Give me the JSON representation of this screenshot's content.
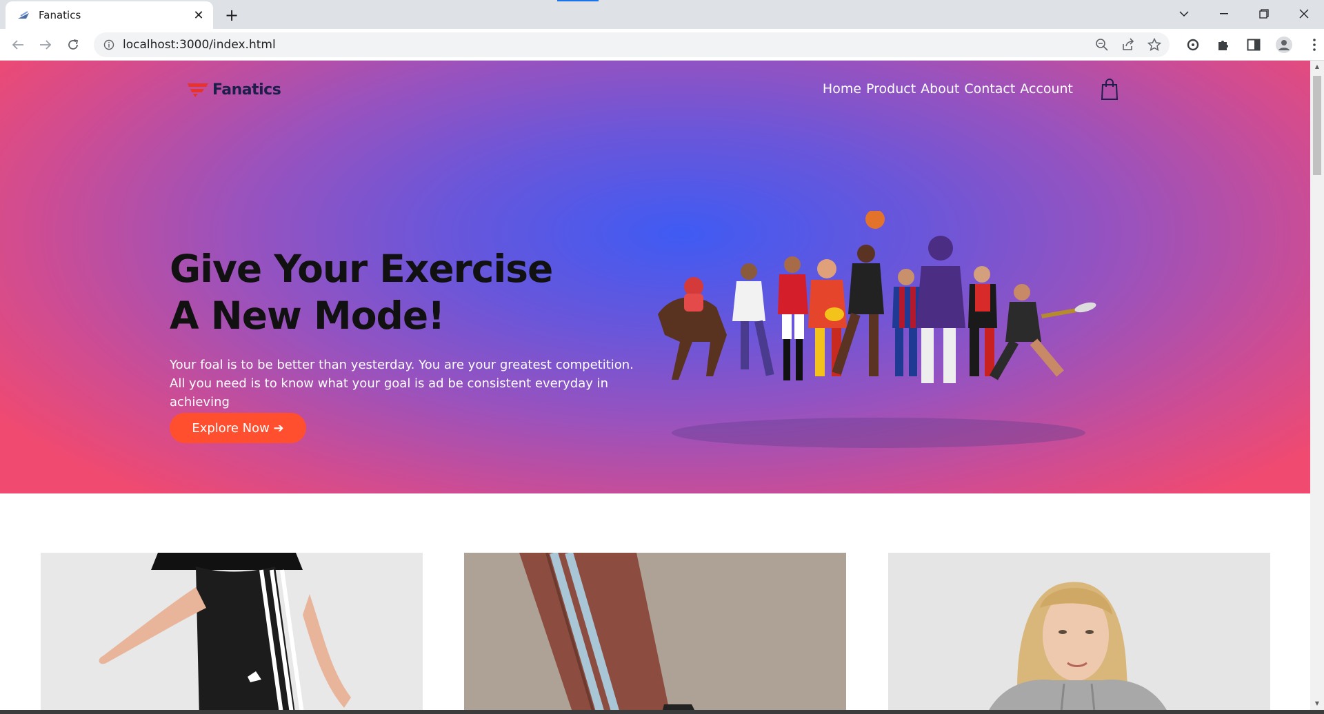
{
  "browser": {
    "tab_title": "Fanatics",
    "url": "localhost:3000/index.html"
  },
  "site": {
    "logo_text": "Fanatics",
    "nav": [
      "Home",
      "Product",
      "About",
      "Contact",
      "Account"
    ],
    "hero": {
      "headline_line1": "Give Your Exercise",
      "headline_line2": "A New Mode!",
      "subtext_line1": "Your foal is to be better than yesterday. You are your greatest competition.",
      "subtext_line2": "All you need is to know what your goal is ad be consistent everyday in",
      "subtext_line3": "achieving",
      "cta_label": "Explore Now ➔"
    },
    "products": [
      {
        "description": "woman in black track pants with white stripes"
      },
      {
        "description": "brown track pants with light blue stripes"
      },
      {
        "description": "blonde woman in grey hoodie"
      }
    ]
  },
  "colors": {
    "hero_center": "#3f5bf3",
    "hero_edge": "#f04a70",
    "cta": "#ff4f2e",
    "logo_text": "#1c1f4a",
    "logo_mark": "#e8322e"
  }
}
